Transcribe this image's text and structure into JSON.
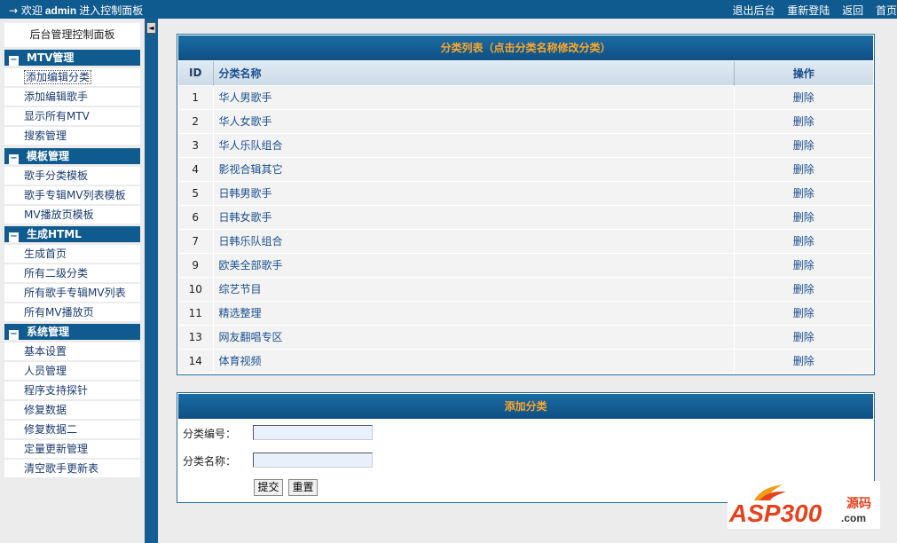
{
  "topbar": {
    "welcome_prefix": "→ 欢迎",
    "user": "admin",
    "welcome_suffix": "进入控制面板",
    "links": [
      "退出后台",
      "重新登陆",
      "返回",
      "首页"
    ]
  },
  "sidebar": {
    "title": "后台管理控制面板",
    "groups": [
      {
        "label": "MTV管理",
        "items": [
          "添加编辑分类",
          "添加编辑歌手",
          "显示所有MTV",
          "搜索管理"
        ]
      },
      {
        "label": "模板管理",
        "items": [
          "歌手分类模板",
          "歌手专辑MV列表模板",
          "MV播放页模板"
        ]
      },
      {
        "label": "生成HTML",
        "items": [
          "生成首页",
          "所有二级分类",
          "所有歌手专辑MV列表",
          "所有MV播放页"
        ]
      },
      {
        "label": "系统管理",
        "items": [
          "基本设置",
          "人员管理",
          "程序支持探针",
          "修复数据",
          "修复数据二",
          "定量更新管理",
          "清空歌手更新表"
        ]
      }
    ],
    "collapse_glyph": "−",
    "split_arrow": "◄"
  },
  "category_list": {
    "title": "分类列表（点击分类名称修改分类）",
    "columns": [
      "ID",
      "分类名称",
      "操作"
    ],
    "rows": [
      {
        "id": "1",
        "name": "华人男歌手",
        "action": "删除"
      },
      {
        "id": "2",
        "name": "华人女歌手",
        "action": "删除"
      },
      {
        "id": "3",
        "name": "华人乐队组合",
        "action": "删除"
      },
      {
        "id": "4",
        "name": "影视合辑其它",
        "action": "删除"
      },
      {
        "id": "5",
        "name": "日韩男歌手",
        "action": "删除"
      },
      {
        "id": "6",
        "name": "日韩女歌手",
        "action": "删除"
      },
      {
        "id": "7",
        "name": "日韩乐队组合",
        "action": "删除"
      },
      {
        "id": "9",
        "name": "欧美全部歌手",
        "action": "删除"
      },
      {
        "id": "10",
        "name": "综艺节目",
        "action": "删除"
      },
      {
        "id": "11",
        "name": "精选整理",
        "action": "删除"
      },
      {
        "id": "13",
        "name": "网友翻唱专区",
        "action": "删除"
      },
      {
        "id": "14",
        "name": "体育视频",
        "action": "删除"
      }
    ]
  },
  "add_form": {
    "title": "添加分类",
    "id_label": "分类编号：",
    "id_value": "",
    "name_label": "分类名称：",
    "name_value": "",
    "submit_label": "提交",
    "reset_label": "重置"
  },
  "watermark": {
    "brand": "ASP300",
    "suffix": ".com",
    "tag": "源码"
  },
  "colors": {
    "nav_blue": "#0f5a8e",
    "caption_orange": "#ffa62a",
    "link_blue": "#1b4f8f"
  }
}
